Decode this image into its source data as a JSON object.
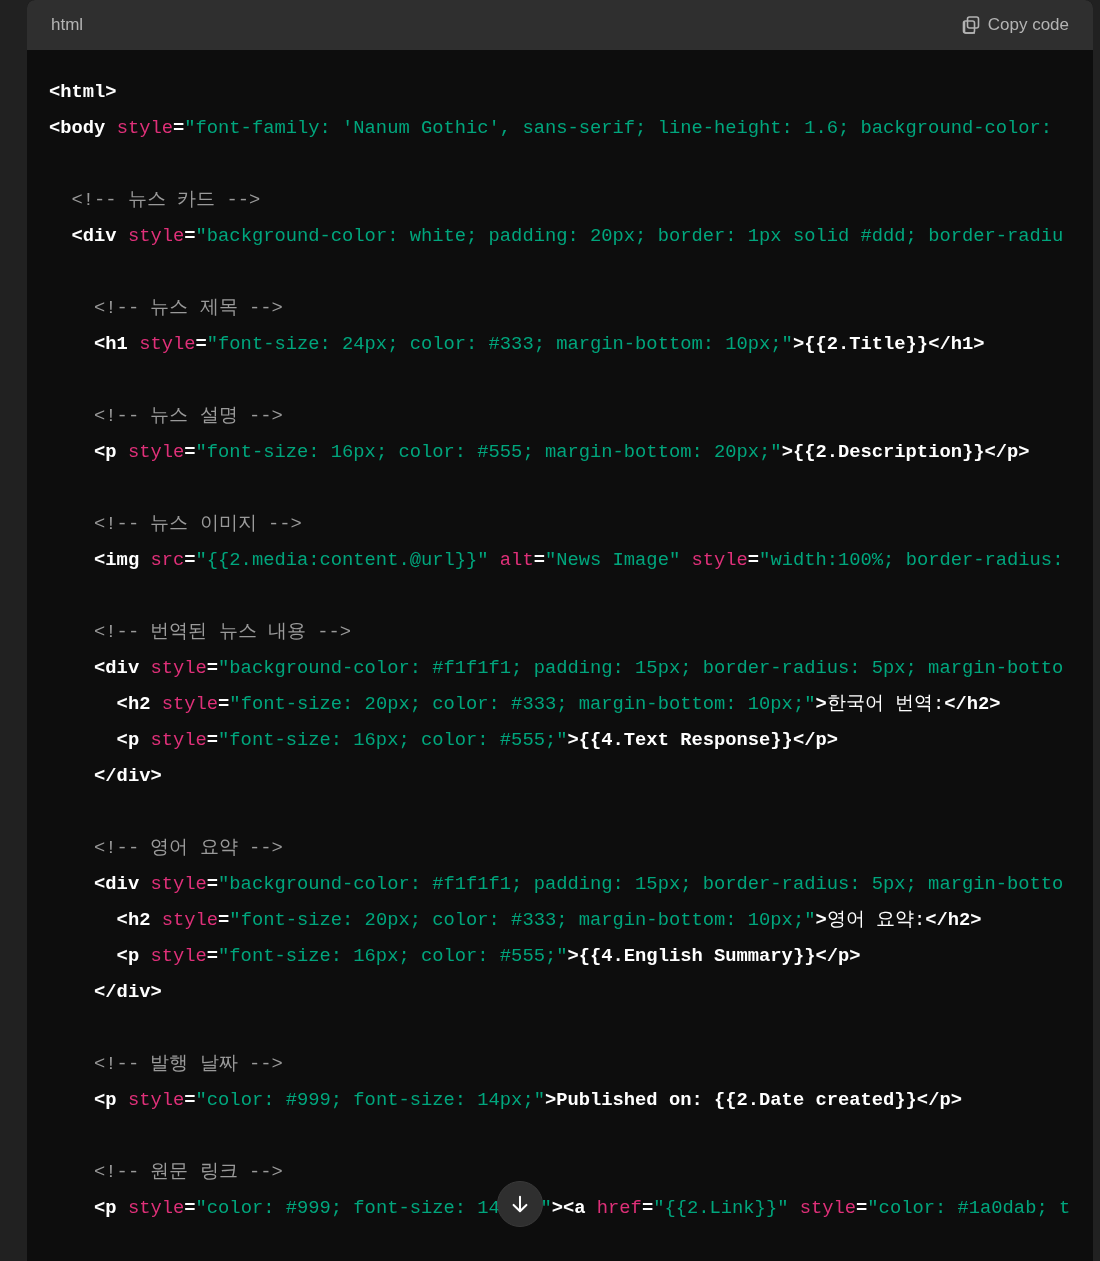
{
  "code_block": {
    "language": "html",
    "copy_button": "Copy code",
    "blocks": [
      [
        {
          "tokens": [
            {
              "kind": "tag",
              "text": "<html>"
            }
          ]
        },
        {
          "tokens": [
            {
              "kind": "tag",
              "text": "<body "
            },
            {
              "kind": "attr",
              "text": "style"
            },
            {
              "kind": "punct",
              "text": "="
            },
            {
              "kind": "str",
              "text": "\"font-family: 'Nanum Gothic', sans-serif; line-height: 1.6; background-color: "
            }
          ]
        }
      ],
      [
        {
          "tokens": [
            {
              "kind": "comment",
              "text": "  <!-- 뉴스 카드 -->"
            }
          ]
        },
        {
          "tokens": [
            {
              "kind": "tag",
              "text": "  <div "
            },
            {
              "kind": "attr",
              "text": "style"
            },
            {
              "kind": "punct",
              "text": "="
            },
            {
              "kind": "str",
              "text": "\"background-color: white; padding: 20px; border: 1px solid #ddd; border-radiu"
            }
          ]
        }
      ],
      [
        {
          "tokens": [
            {
              "kind": "comment",
              "text": "    <!-- 뉴스 제목 -->"
            }
          ]
        },
        {
          "tokens": [
            {
              "kind": "tag",
              "text": "    <h1 "
            },
            {
              "kind": "attr",
              "text": "style"
            },
            {
              "kind": "punct",
              "text": "="
            },
            {
              "kind": "str",
              "text": "\"font-size: 24px; color: #333; margin-bottom: 10px;\""
            },
            {
              "kind": "tag",
              "text": ">{{2.Title}}</h1>"
            }
          ]
        }
      ],
      [
        {
          "tokens": [
            {
              "kind": "comment",
              "text": "    <!-- 뉴스 설명 -->"
            }
          ]
        },
        {
          "tokens": [
            {
              "kind": "tag",
              "text": "    <p "
            },
            {
              "kind": "attr",
              "text": "style"
            },
            {
              "kind": "punct",
              "text": "="
            },
            {
              "kind": "str",
              "text": "\"font-size: 16px; color: #555; margin-bottom: 20px;\""
            },
            {
              "kind": "tag",
              "text": ">{{2.Description}}</p>"
            }
          ]
        }
      ],
      [
        {
          "tokens": [
            {
              "kind": "comment",
              "text": "    <!-- 뉴스 이미지 -->"
            }
          ]
        },
        {
          "tokens": [
            {
              "kind": "tag",
              "text": "    <img "
            },
            {
              "kind": "attr",
              "text": "src"
            },
            {
              "kind": "punct",
              "text": "="
            },
            {
              "kind": "str",
              "text": "\"{{2.media:content.@url}}\" "
            },
            {
              "kind": "attr",
              "text": "alt"
            },
            {
              "kind": "punct",
              "text": "="
            },
            {
              "kind": "str",
              "text": "\"News Image\" "
            },
            {
              "kind": "attr",
              "text": "style"
            },
            {
              "kind": "punct",
              "text": "="
            },
            {
              "kind": "str",
              "text": "\"width:100%; border-radius:"
            }
          ]
        }
      ],
      [
        {
          "tokens": [
            {
              "kind": "comment",
              "text": "    <!-- 번역된 뉴스 내용 -->"
            }
          ]
        },
        {
          "tokens": [
            {
              "kind": "tag",
              "text": "    <div "
            },
            {
              "kind": "attr",
              "text": "style"
            },
            {
              "kind": "punct",
              "text": "="
            },
            {
              "kind": "str",
              "text": "\"background-color: #f1f1f1; padding: 15px; border-radius: 5px; margin-botto"
            }
          ]
        },
        {
          "tokens": [
            {
              "kind": "tag",
              "text": "      <h2 "
            },
            {
              "kind": "attr",
              "text": "style"
            },
            {
              "kind": "punct",
              "text": "="
            },
            {
              "kind": "str",
              "text": "\"font-size: 20px; color: #333; margin-bottom: 10px;\""
            },
            {
              "kind": "tag",
              "text": ">"
            },
            {
              "kind": "text",
              "text": "한국어 번역:"
            },
            {
              "kind": "tag",
              "text": "</h2>"
            }
          ]
        },
        {
          "tokens": [
            {
              "kind": "tag",
              "text": "      <p "
            },
            {
              "kind": "attr",
              "text": "style"
            },
            {
              "kind": "punct",
              "text": "="
            },
            {
              "kind": "str",
              "text": "\"font-size: 16px; color: #555;\""
            },
            {
              "kind": "tag",
              "text": ">{{4.Text Response}}</p>"
            }
          ]
        },
        {
          "tokens": [
            {
              "kind": "tag",
              "text": "    </div>"
            }
          ]
        }
      ],
      [
        {
          "tokens": [
            {
              "kind": "comment",
              "text": "    <!-- 영어 요약 -->"
            }
          ]
        },
        {
          "tokens": [
            {
              "kind": "tag",
              "text": "    <div "
            },
            {
              "kind": "attr",
              "text": "style"
            },
            {
              "kind": "punct",
              "text": "="
            },
            {
              "kind": "str",
              "text": "\"background-color: #f1f1f1; padding: 15px; border-radius: 5px; margin-botto"
            }
          ]
        },
        {
          "tokens": [
            {
              "kind": "tag",
              "text": "      <h2 "
            },
            {
              "kind": "attr",
              "text": "style"
            },
            {
              "kind": "punct",
              "text": "="
            },
            {
              "kind": "str",
              "text": "\"font-size: 20px; color: #333; margin-bottom: 10px;\""
            },
            {
              "kind": "tag",
              "text": ">"
            },
            {
              "kind": "text",
              "text": "영어 요약:"
            },
            {
              "kind": "tag",
              "text": "</h2>"
            }
          ]
        },
        {
          "tokens": [
            {
              "kind": "tag",
              "text": "      <p "
            },
            {
              "kind": "attr",
              "text": "style"
            },
            {
              "kind": "punct",
              "text": "="
            },
            {
              "kind": "str",
              "text": "\"font-size: 16px; color: #555;\""
            },
            {
              "kind": "tag",
              "text": ">{{4.English Summary}}</p>"
            }
          ]
        },
        {
          "tokens": [
            {
              "kind": "tag",
              "text": "    </div>"
            }
          ]
        }
      ],
      [
        {
          "tokens": [
            {
              "kind": "comment",
              "text": "    <!-- 발행 날짜 -->"
            }
          ]
        },
        {
          "tokens": [
            {
              "kind": "tag",
              "text": "    <p "
            },
            {
              "kind": "attr",
              "text": "style"
            },
            {
              "kind": "punct",
              "text": "="
            },
            {
              "kind": "str",
              "text": "\"color: #999; font-size: 14px;\""
            },
            {
              "kind": "tag",
              "text": ">Published on: {{2.Date created}}</p>"
            }
          ]
        }
      ],
      [
        {
          "tokens": [
            {
              "kind": "comment",
              "text": "    <!-- 원문 링크 -->"
            }
          ]
        },
        {
          "covered": true,
          "tokens": [
            {
              "kind": "tag",
              "text": "    <p "
            },
            {
              "kind": "attr",
              "text": "style"
            },
            {
              "kind": "punct",
              "text": "="
            },
            {
              "kind": "str",
              "text": "\"color: #999; font-size: 14"
            },
            {
              "kind": "gap"
            },
            {
              "kind": "str",
              "text": "\""
            },
            {
              "kind": "tag",
              "text": "><a "
            },
            {
              "kind": "attr",
              "text": "href"
            },
            {
              "kind": "punct",
              "text": "="
            },
            {
              "kind": "str",
              "text": "\"{{2.Link}}\" "
            },
            {
              "kind": "attr",
              "text": "style"
            },
            {
              "kind": "punct",
              "text": "="
            },
            {
              "kind": "str",
              "text": "\"color: #1a0dab; t"
            }
          ]
        }
      ]
    ]
  }
}
